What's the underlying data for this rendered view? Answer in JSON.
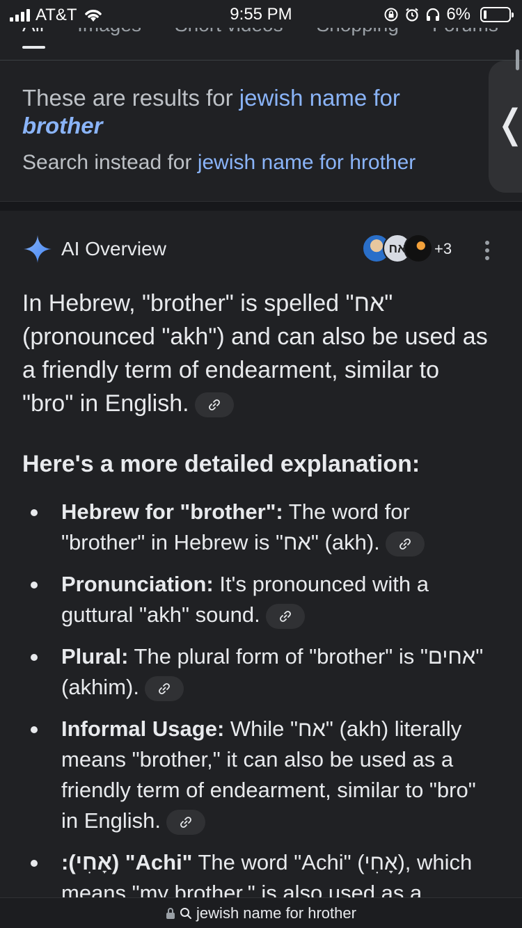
{
  "status_bar": {
    "carrier": "AT&T",
    "time": "9:55 PM",
    "battery_percent": "6%",
    "battery_level": 0.06
  },
  "tabs": [
    {
      "label": "All",
      "active": true
    },
    {
      "label": "Images"
    },
    {
      "label": "Short videos"
    },
    {
      "label": "Shopping"
    },
    {
      "label": "Forums"
    }
  ],
  "correction": {
    "prefix": "These are results for ",
    "corrected_query_plain": "jewish name for",
    "corrected_query_bold": "brother",
    "instead_prefix": "Search instead for ",
    "original_query": "jewish name for hrother"
  },
  "ai_overview": {
    "title": "AI Overview",
    "source_count": "+3",
    "source_avatar_text": "אח",
    "paragraph": "In Hebrew, \"brother\" is spelled \"אח\" (pronounced \"akh\") and can also be used as a friendly term of endearment, similar to \"bro\" in English.",
    "subheading": "Here's a more detailed explanation:",
    "bullets": [
      {
        "bold": "Hebrew for \"brother\":",
        "text": " The word for \"brother\" in Hebrew is \"אח\" (akh).",
        "has_link": true
      },
      {
        "bold": "Pronunciation:",
        "text": " It's pronounced with a guttural \"akh\" sound.",
        "has_link": true
      },
      {
        "bold": "Plural:",
        "text": " The plural form of \"brother\" is \"אחים\" (akhim).",
        "has_link": true
      },
      {
        "bold": "Informal Usage:",
        "text": " While \"אח\" (akh) literally means \"brother,\" it can also be used as a friendly term of endearment, similar to \"bro\" in English.",
        "has_link": true
      },
      {
        "bold": ":(אָחִי) \"Achi\"",
        "text": " The word \"Achi\" (אָחִי), which means \"my brother,\" is also used as a",
        "has_link": false
      }
    ]
  },
  "url_bar": {
    "text": "jewish name for hrother",
    "lock_icon": "lock-icon",
    "search_icon": "search-icon"
  }
}
